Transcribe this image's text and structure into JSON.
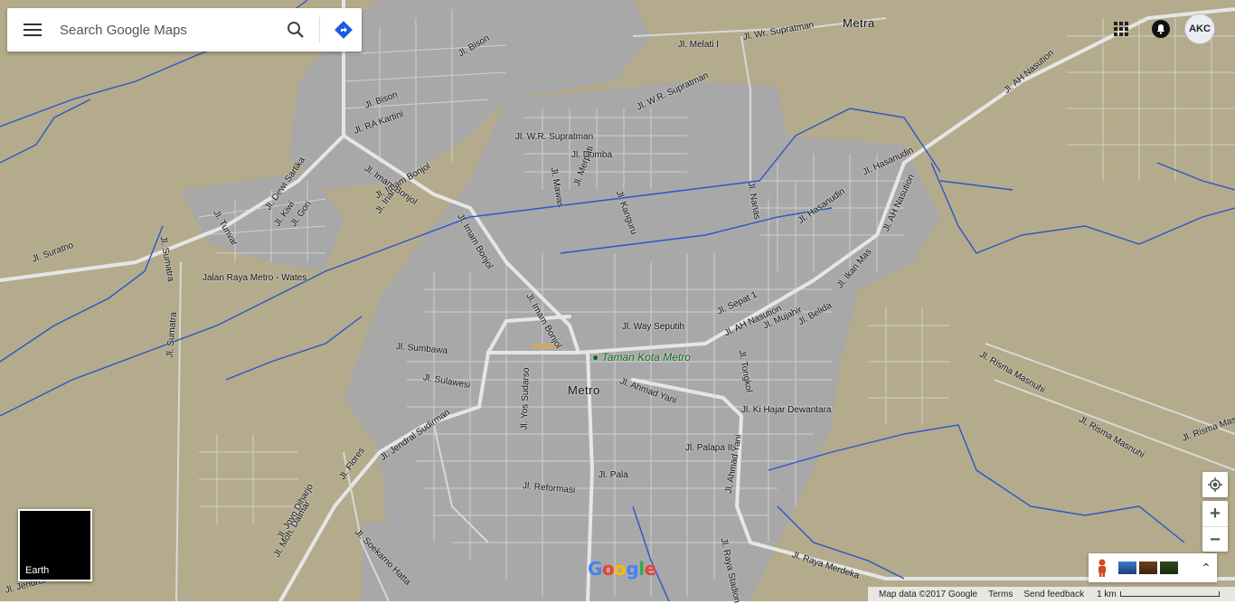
{
  "search": {
    "placeholder": "Search Google Maps"
  },
  "top": {
    "apps_icon": "apps-grid-icon",
    "notif_icon": "notification-icon",
    "avatar_text": "AKC"
  },
  "map": {
    "colors": {
      "land": "#b4ab8c",
      "urban": "#a9a9aa",
      "road": "#e2e2e2",
      "water": "#2f56c6"
    },
    "city_labels": [
      "Metro",
      "Metra"
    ],
    "poi": "Taman Kota Metro",
    "street_labels": [
      "Jl. Bison",
      "Jl. Bison",
      "Jl. RA Kartini",
      "Jl. Melati I",
      "Jl. Wr. Supratman",
      "Jl. W.R. Supratman",
      "Jl. W.R. Supratman",
      "Jl. Domba",
      "Jl. Mawas",
      "Jl. Merpati",
      "Jl. Kanguru",
      "Jl. Nanas",
      "Jl. Hasanudin",
      "Jl. Hasanudin",
      "Jl. AH Nasution",
      "Jl. AH Nasution",
      "Jl. AH Nasution",
      "Jl. Imam Bonjol",
      "Jl. Imam Bonjol",
      "Jl. Imam Bonjol",
      "Jl. Imam Bonjol",
      "Jl. Irian",
      "Jl. Dewi Sartika",
      "Jl. Kiwi",
      "Jl. Gori",
      "Jl. Tunvar",
      "Jl. Suratno",
      "Jl. Sumatra",
      "Jalan Raya Metro - Wates",
      "Jl. Sumatra",
      "Jl. Sumbawa",
      "Jl. Sulawesi",
      "Jl. Jendral Sudirman",
      "Jl. Flores",
      "Jl. Yos Sudarso",
      "Jl. Way Seputih",
      "Jl. Ahmad Yani",
      "Jl. Sepat 1",
      "Jl. Mujahir",
      "Jl. Belida",
      "Jl. Ikan Mas",
      "Jl. Tongkol",
      "Jl. Ki Hajar Dewantara",
      "Jl. Palapa II",
      "Jl. Ahmad Yani",
      "Jl. Pala",
      "Jl. Reformasi",
      "Jl. Joyo Diharjo",
      "Jl. Moh. Dalmar",
      "Jl. Soekarno Hatta",
      "Jl. Raya Stadion",
      "Jl. Raya Merdeka",
      "Jl. Risma Masnuhi",
      "Jl. Risma Masnuhi",
      "Jl. Risma Masnuhi",
      "Jl. Jendral S"
    ]
  },
  "earth": {
    "label": "Earth"
  },
  "controls": {
    "locate_icon": "my-location-icon",
    "zoom_in": "+",
    "zoom_out": "−",
    "pegman_icon": "pegman-icon",
    "layers_toggle": "⌃"
  },
  "logo": "Google",
  "footer": {
    "map_data": "Map data ©2017 Google",
    "terms": "Terms",
    "feedback": "Send feedback",
    "scale": "1 km"
  }
}
